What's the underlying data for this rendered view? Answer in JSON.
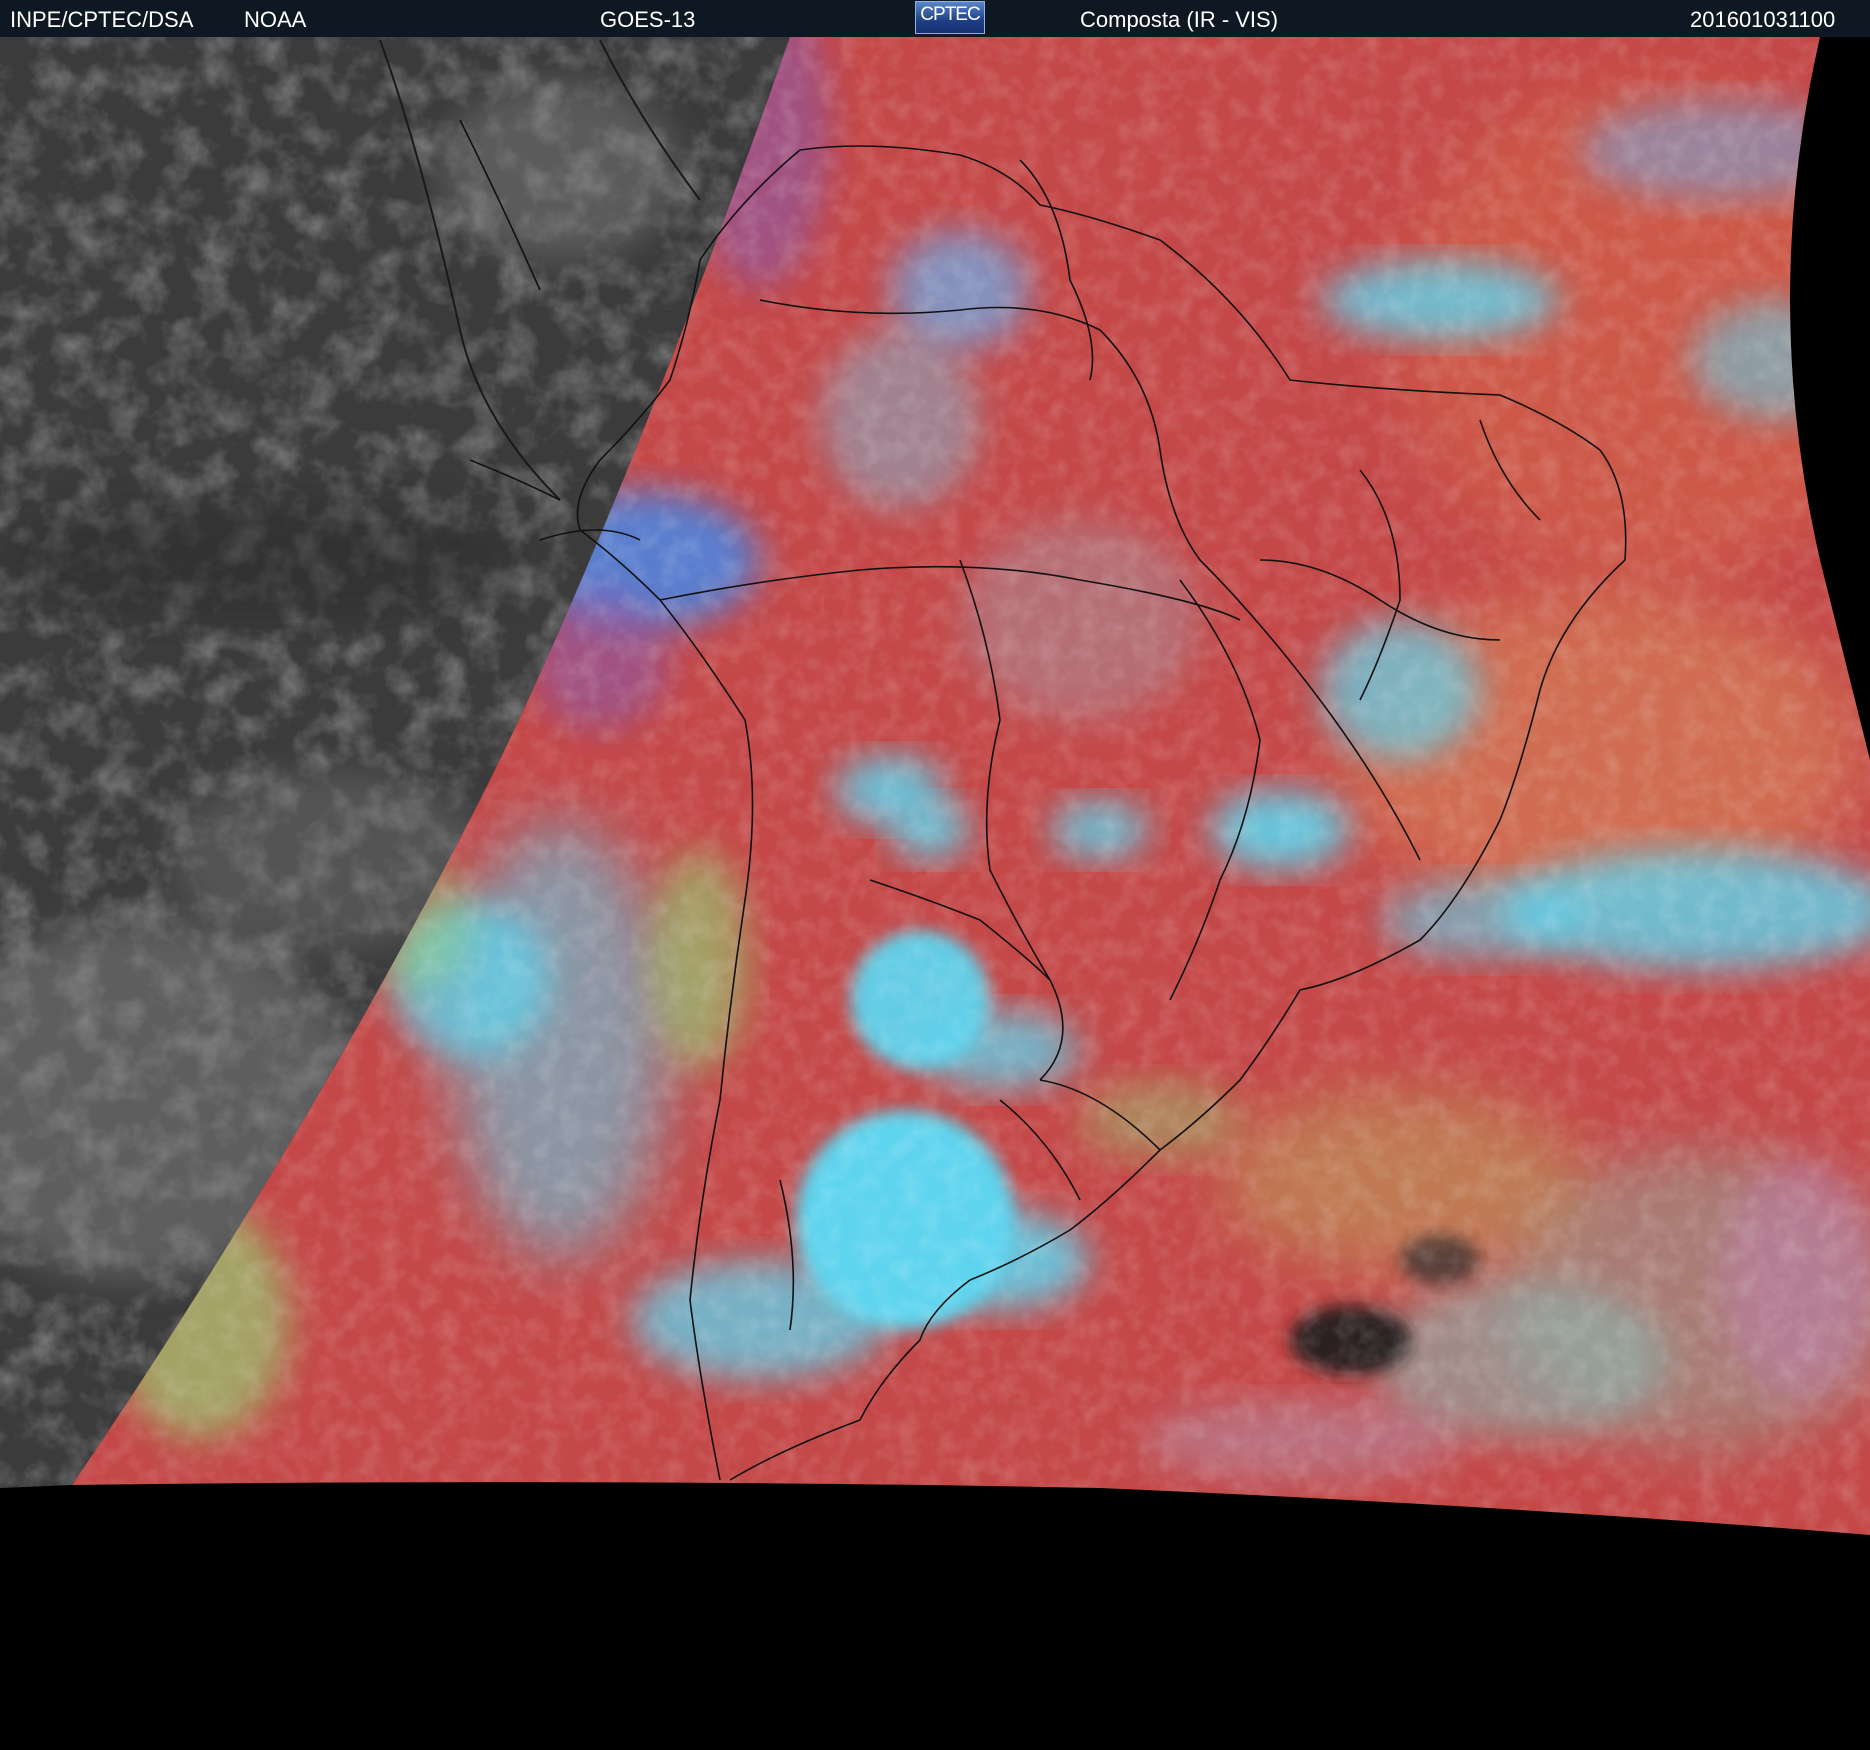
{
  "header": {
    "org": "INPE/CPTEC/DSA",
    "agency": "NOAA",
    "satellite": "GOES-13",
    "logo_text": "CPTEC",
    "product": "Composta (IR - VIS)",
    "timestamp": "201601031100"
  },
  "colors": {
    "header_bg": "#0d1822",
    "night_side": "#3a3a3a",
    "composite_red": "#c44848",
    "cloud_cyan": "#5fd4ee",
    "cloud_blue": "#3f8cf0",
    "cloud_green": "#8fe07a",
    "no_data": "#000000",
    "border_lines": "#111111"
  }
}
